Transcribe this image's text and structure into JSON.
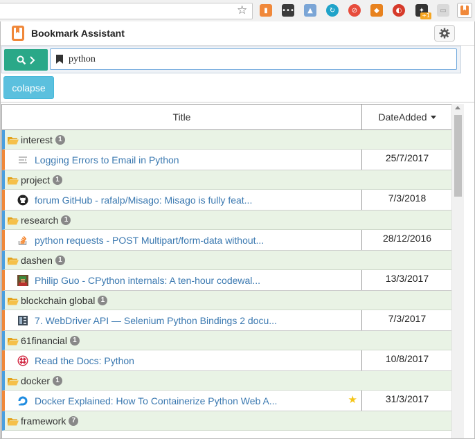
{
  "app": {
    "title": "Bookmark Assistant",
    "colors": {
      "accent": "#2aa888",
      "info": "#5bc0de",
      "folder_bg": "#e9f3e5",
      "folder_bar": "#4a9fe0",
      "bookmark_bar": "#f0883a",
      "link": "#3a78b0"
    }
  },
  "search": {
    "value": "python"
  },
  "toolbar": {
    "collapse_label": "colapse"
  },
  "table": {
    "headers": {
      "title": "Title",
      "date": "DateAdded"
    },
    "groups": [
      {
        "folder": "interest",
        "count": "1",
        "bookmark": {
          "title": "Logging Errors to Email in Python",
          "date": "25/7/2017",
          "icon": "lines-icon"
        }
      },
      {
        "folder": "project",
        "count": "1",
        "bookmark": {
          "title": "forum GitHub - rafalp/Misago: Misago is fully feat...",
          "date": "7/3/2018",
          "icon": "github-icon"
        }
      },
      {
        "folder": "research",
        "count": "1",
        "bookmark": {
          "title": "python requests - POST Multipart/form-data without...",
          "date": "28/12/2016",
          "icon": "stackoverflow-icon"
        }
      },
      {
        "folder": "dashen",
        "count": "1",
        "bookmark": {
          "title": "Philip Guo - CPython internals: A ten-hour codewal...",
          "date": "13/3/2017",
          "icon": "pixel-avatar-icon"
        }
      },
      {
        "folder": "blockchain global",
        "count": "1",
        "bookmark": {
          "title": "7. WebDriver API — Selenium Python Bindings 2 docu...",
          "date": "7/3/2017",
          "icon": "docs-book-icon"
        }
      },
      {
        "folder": "61financial",
        "count": "1",
        "bookmark": {
          "title": "Read the Docs: Python",
          "date": "10/8/2017",
          "icon": "readthedocs-icon"
        }
      },
      {
        "folder": "docker",
        "count": "1",
        "bookmark": {
          "title": "Docker Explained: How To Containerize Python Web A...",
          "date": "31/3/2017",
          "icon": "digitalocean-icon",
          "starred": true
        }
      },
      {
        "folder": "framework",
        "count": "7"
      }
    ]
  }
}
